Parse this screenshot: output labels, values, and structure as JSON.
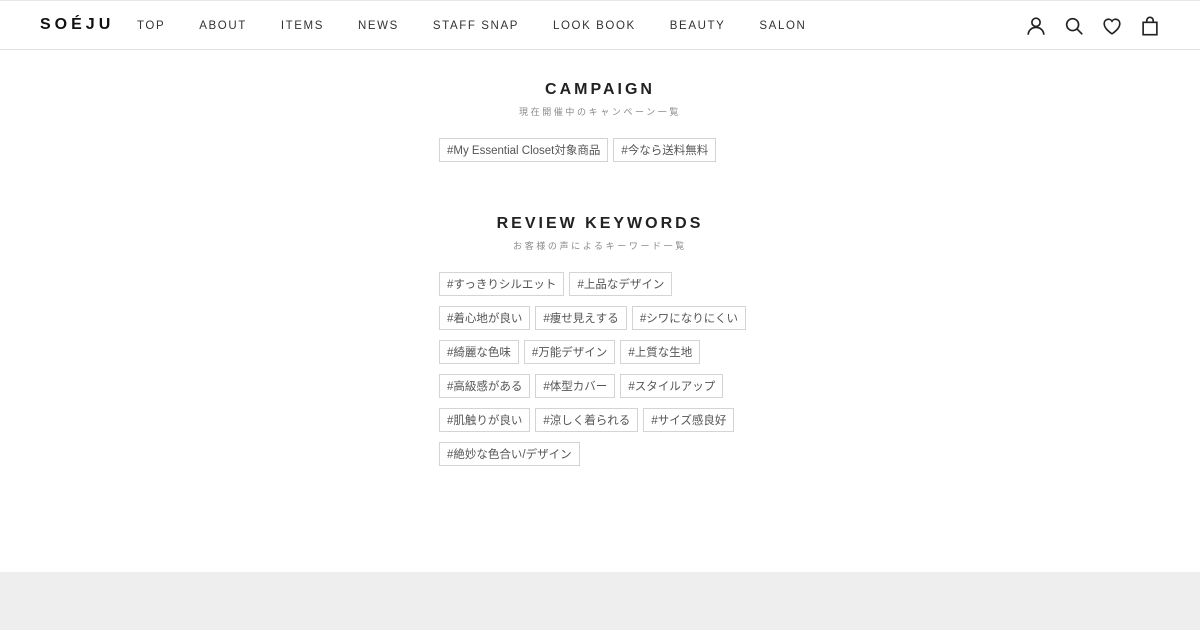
{
  "brand": {
    "logo": "SOÉJU"
  },
  "nav": {
    "items": [
      "TOP",
      "ABOUT",
      "ITEMS",
      "NEWS",
      "STAFF SNAP",
      "LOOK BOOK",
      "BEAUTY",
      "SALON"
    ]
  },
  "header_icons": [
    "user-icon",
    "search-icon",
    "heart-icon",
    "bag-icon"
  ],
  "campaign": {
    "title": "CAMPAIGN",
    "subtitle": "現在開催中のキャンペーン一覧",
    "tags": [
      "#My Essential Closet対象商品",
      "#今なら送料無料"
    ]
  },
  "review": {
    "title": "REVIEW KEYWORDS",
    "subtitle": "お客様の声によるキーワード一覧",
    "rows": [
      [
        "#すっきりシルエット",
        "#上品なデザイン"
      ],
      [
        "#着心地が良い",
        "#痩せ見えする",
        "#シワになりにくい"
      ],
      [
        "#綺麗な色味",
        "#万能デザイン",
        "#上質な生地"
      ],
      [
        "#高級感がある",
        "#体型カバー",
        "#スタイルアップ"
      ],
      [
        "#肌触りが良い",
        "#涼しく着られる",
        "#サイズ感良好"
      ],
      [
        "#絶妙な色合い/デザイン"
      ]
    ]
  },
  "colors": {
    "footer_band": "#eeeeee",
    "tag_border": "#d4d4d4"
  }
}
